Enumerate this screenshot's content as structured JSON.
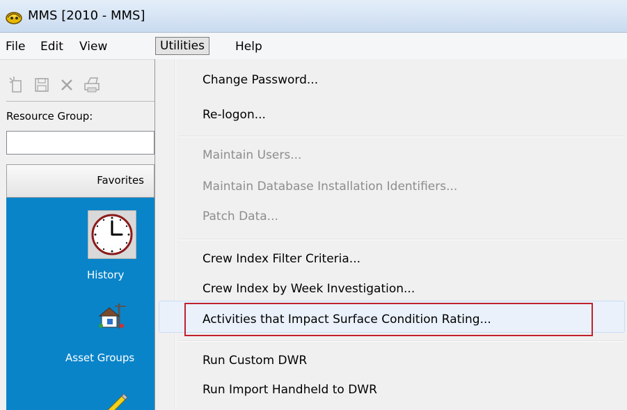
{
  "window": {
    "title": "MMS [2010 - MMS]"
  },
  "menubar": {
    "items": [
      {
        "label": "File"
      },
      {
        "label": "Edit"
      },
      {
        "label": "View"
      },
      {
        "label": "Utilities"
      },
      {
        "label": "Help"
      }
    ]
  },
  "left_panel": {
    "resource_group_label": "Resource Group:",
    "resource_group_value": "",
    "favorites_tab": "Favorites",
    "shortcuts": [
      {
        "label": "History",
        "icon": "clock-icon"
      },
      {
        "label": "Asset Groups",
        "icon": "house-icon"
      },
      {
        "label": "",
        "icon": "pencil-icon"
      }
    ]
  },
  "utilities_menu": {
    "items": [
      {
        "label": "Change Password...",
        "enabled": true
      },
      {
        "label": "Re-logon...",
        "enabled": true
      },
      {
        "label": "Maintain Users...",
        "enabled": false
      },
      {
        "label": "Maintain Database Installation Identifiers...",
        "enabled": false
      },
      {
        "label": "Patch Data...",
        "enabled": false
      },
      {
        "label": "Crew Index Filter Criteria...",
        "enabled": true
      },
      {
        "label": "Crew Index by Week Investigation...",
        "enabled": true
      },
      {
        "label": "Activities that Impact Surface Condition Rating...",
        "enabled": true,
        "highlighted": true
      },
      {
        "label": "Run Custom DWR",
        "enabled": true
      },
      {
        "label": "Run Import Handheld to DWR",
        "enabled": true
      }
    ]
  },
  "colors": {
    "shortcut_panel": "#0a84c9",
    "annotation_box": "#c0202b"
  }
}
